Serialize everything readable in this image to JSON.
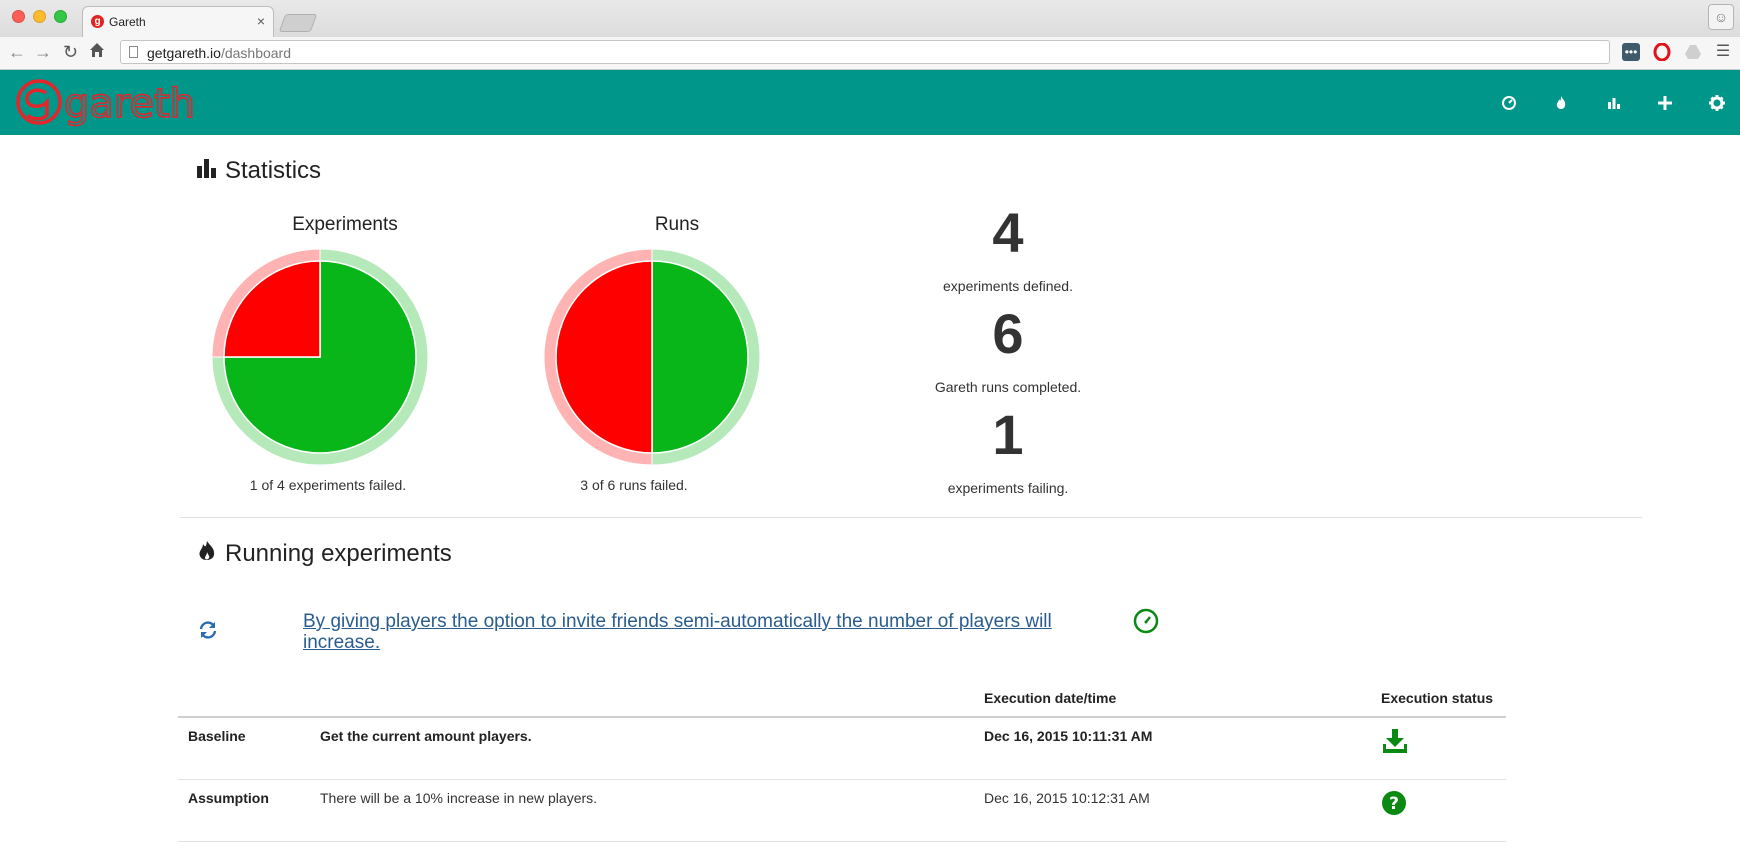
{
  "browser": {
    "tab_title": "Gareth",
    "url_domain": "getgareth.io",
    "url_path": "/dashboard"
  },
  "app": {
    "logo_text": "gareth",
    "brand_color": "#00968a",
    "nav_icons": [
      "dashboard-icon",
      "fire-icon",
      "bar-chart-icon",
      "plus-icon",
      "gear-icon"
    ]
  },
  "statistics": {
    "title": "Statistics",
    "experiments_chart": {
      "title": "Experiments",
      "caption": "1 of 4 experiments failed."
    },
    "runs_chart": {
      "title": "Runs",
      "caption": "3 of 6 runs failed."
    },
    "counters": [
      {
        "value": "4",
        "label": "experiments defined.",
        "color": "#008a00"
      },
      {
        "value": "6",
        "label": "Gareth runs completed.",
        "color": "#c4c4c4"
      },
      {
        "value": "1",
        "label": "experiments failing.",
        "color": "#ee1111"
      }
    ]
  },
  "chart_data": [
    {
      "type": "pie",
      "title": "Experiments",
      "categories": [
        "failed",
        "passed"
      ],
      "values": [
        1,
        3
      ],
      "colors": [
        "#ff0000",
        "#09b61a"
      ]
    },
    {
      "type": "pie",
      "title": "Runs",
      "categories": [
        "failed",
        "passed"
      ],
      "values": [
        3,
        3
      ],
      "colors": [
        "#ff0000",
        "#09b61a"
      ]
    }
  ],
  "running": {
    "title": "Running experiments",
    "experiment_link": "By giving players the option to invite friends semi-automatically the number of players will increase.",
    "table": {
      "headers": [
        "",
        "",
        "Execution date/time",
        "Execution status"
      ],
      "rows": [
        {
          "kind": "Baseline",
          "description": "Get the current amount players.",
          "datetime": "Dec 16, 2015 10:11:31 AM",
          "status_icon": "download-icon"
        },
        {
          "kind": "Assumption",
          "description": "There will be a 10% increase in new players.",
          "datetime": "Dec 16, 2015 10:12:31 AM",
          "status_icon": "question-icon"
        }
      ]
    }
  }
}
